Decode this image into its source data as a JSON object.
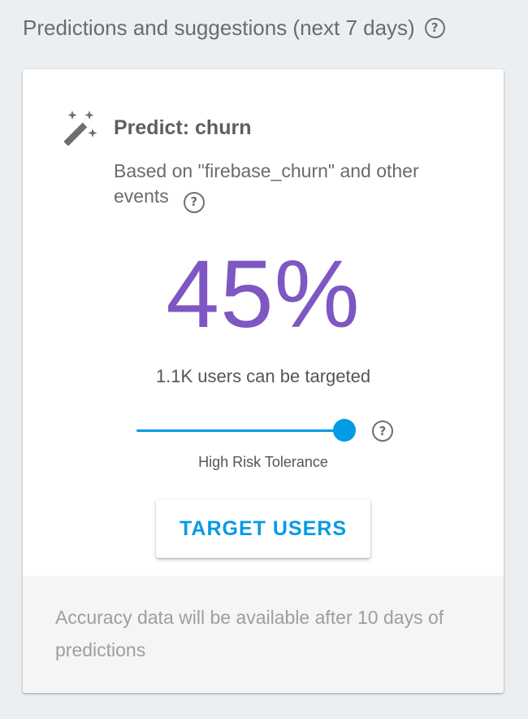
{
  "header": {
    "title": "Predictions and suggestions (next 7 days)",
    "help_icon": "help-circle-icon"
  },
  "card": {
    "icon": "magic-wand-icon",
    "title": "Predict: churn",
    "description": "Based on \"firebase_churn\" and other events",
    "description_help_icon": "help-circle-icon",
    "percentage": "45%",
    "users_text": "1.1K users can be targeted",
    "slider": {
      "value": 1.0,
      "label": "High Risk Tolerance",
      "help_icon": "help-circle-icon"
    },
    "button_label": "TARGET USERS",
    "footer_text": "Accuracy data will be available after 10 days of predictions"
  },
  "colors": {
    "accent": "#039be5",
    "percentage": "#7e57c2",
    "page_background": "#eceff1",
    "footer_background": "#f5f5f5"
  }
}
